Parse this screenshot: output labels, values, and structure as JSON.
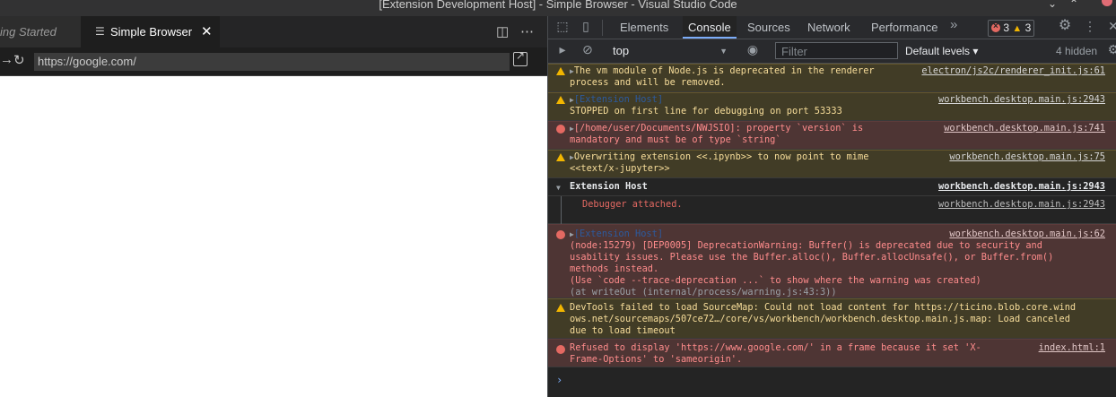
{
  "window": {
    "title": "[Extension Development Host] - Simple Browser - Visual Studio Code",
    "controls": [
      "⌄",
      "⌃"
    ]
  },
  "editor": {
    "tabs": [
      {
        "label": "ing Started",
        "active": false
      },
      {
        "label": "Simple Browser",
        "active": true,
        "icon": "browser-file-icon"
      }
    ],
    "tab_tools": [
      "split-editor-icon",
      "more-actions-icon"
    ],
    "url": "https://google.com/",
    "page_color": "#ffffff"
  },
  "devtools": {
    "tabs": [
      "Elements",
      "Console",
      "Sources",
      "Network",
      "Performance"
    ],
    "active_tab": "Console",
    "error_count": "3",
    "warning_count": "3",
    "context": "top",
    "filter_placeholder": "Filter",
    "levels": "Default levels",
    "hidden_count": "4 hidden",
    "messages": [
      {
        "level": "warn",
        "lines": [
          "The vm module of Node.js is deprecated in the renderer",
          "process and will be removed."
        ],
        "source": "electron/js2c/renderer_init.js:61"
      },
      {
        "level": "warn",
        "lines": [
          "[Extension Host]",
          "STOPPED on first line for debugging on port 53333"
        ],
        "source": "workbench.desktop.main.js:2943"
      },
      {
        "level": "err",
        "lines": [
          "[/home/user/Documents/NWJSIO]: property `version` is",
          "mandatory and must be of type `string`"
        ],
        "source": "workbench.desktop.main.js:741"
      },
      {
        "level": "warn",
        "lines": [
          "Overwriting extension <<.ipynb>> to now point to mime",
          "<<text/x-jupyter>>"
        ],
        "source": "workbench.desktop.main.js:75"
      },
      {
        "level": "group",
        "lines": [
          "Extension Host"
        ],
        "source": "workbench.desktop.main.js:2943"
      },
      {
        "level": "info",
        "lines": [
          "Debugger attached."
        ],
        "source": "workbench.desktop.main.js:2943"
      },
      {
        "level": "err",
        "lines": [
          "[Extension Host]",
          "(node:15279) [DEP0005] DeprecationWarning: Buffer() is deprecated due to security and",
          "usability issues. Please use the Buffer.alloc(), Buffer.allocUnsafe(), or Buffer.from()",
          "methods instead.",
          "(Use `code --trace-deprecation ...` to show where the warning was created)",
          "(at writeOut (internal/process/warning.js:43:3))"
        ],
        "source": "workbench.desktop.main.js:62"
      },
      {
        "level": "warn",
        "lines": [
          "DevTools failed to load SourceMap: Could not load content for https://ticino.blob.core.wind",
          "ows.net/sourcemaps/507ce72…/core/vs/workbench/workbench.desktop.main.js.map: Load canceled",
          "due to load timeout"
        ],
        "source": ""
      },
      {
        "level": "err",
        "lines": [
          "Refused to display 'https://www.google.com/' in a frame because it set 'X-",
          "Frame-Options' to 'sameorigin'."
        ],
        "source": "index.html:1"
      }
    ],
    "prompt": "›"
  }
}
